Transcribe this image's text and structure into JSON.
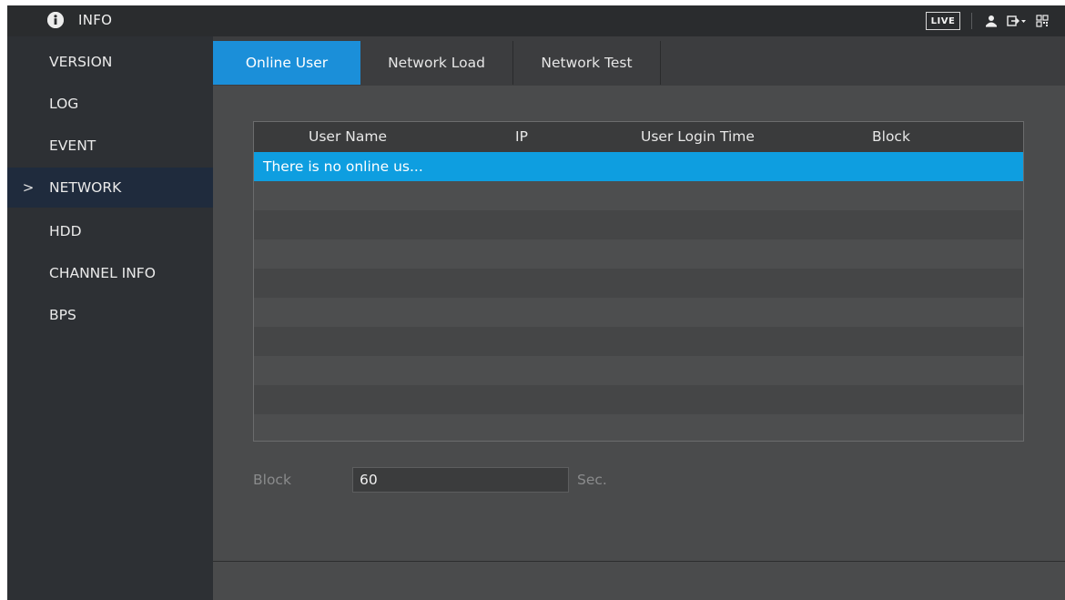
{
  "header": {
    "title": "INFO",
    "live_label": "LIVE",
    "icons": [
      "info-icon",
      "user-icon",
      "logout-icon",
      "qr-code-icon"
    ]
  },
  "sidebar": {
    "items": [
      {
        "label": "VERSION",
        "active": false
      },
      {
        "label": "LOG",
        "active": false
      },
      {
        "label": "EVENT",
        "active": false
      },
      {
        "label": "NETWORK",
        "active": true,
        "marker": ">"
      },
      {
        "label": "HDD",
        "active": false
      },
      {
        "label": "CHANNEL INFO",
        "active": false
      },
      {
        "label": "BPS",
        "active": false
      }
    ]
  },
  "tabs": [
    {
      "label": "Online User",
      "active": true
    },
    {
      "label": "Network Load",
      "active": false
    },
    {
      "label": "Network Test",
      "active": false
    }
  ],
  "table": {
    "columns": [
      "User Name",
      "IP",
      "User Login Time",
      "Block"
    ],
    "selected_row_text": "There is no online us..."
  },
  "block": {
    "label": "Block",
    "value": "60",
    "unit": "Sec."
  },
  "colors": {
    "accent": "#1b8fd9",
    "selection": "#0e9ee0",
    "sidebar_bg": "#2d3034",
    "sidebar_active": "#1f2b3d"
  }
}
